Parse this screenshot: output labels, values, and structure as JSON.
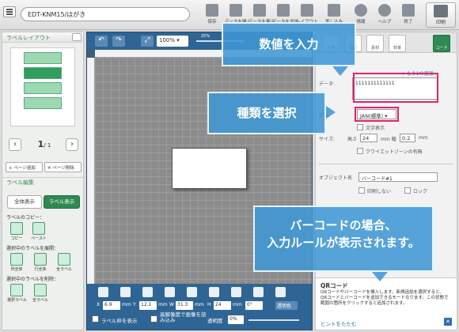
{
  "app": {
    "filename": "EDT-KNM15/はがき",
    "toolbar": [
      {
        "label": "保存"
      },
      {
        "label": "データを開く"
      },
      {
        "label": "データを書込"
      },
      {
        "label": "データを追加"
      },
      {
        "label": "レイアウト"
      },
      {
        "label": "差し込み"
      },
      {
        "label": "情報"
      },
      {
        "label": "ヘルプ"
      },
      {
        "label": "終了"
      }
    ],
    "print_label": "印刷"
  },
  "left_panel": {
    "layout_title": "ラベルレイアウト",
    "page_current": "1",
    "page_total": "/ 1",
    "add_page": "+ ページ追加",
    "delete_page": "✕ ページ削除",
    "edit_title": "ラベル編集",
    "show_all": "全体表示",
    "show_label": "ラベル表示",
    "copy_group": "ラベルのコピー：",
    "copy_btn": "コピー",
    "paste_btn": "ペースト",
    "fill_group": "選択中のラベルを展開：",
    "fill_col": "列全体",
    "fill_row": "行全体",
    "fill_all": "全ラベル",
    "delete_group": "選択中のラベルを削除：",
    "delete_selected": "選択ラベル",
    "delete_all": "全ラベル"
  },
  "canvas": {
    "zoom": "100%",
    "zoom_percent": "25%",
    "x_label": "X",
    "x_value": "6.9",
    "y_label": "Y",
    "y_value": "12.1",
    "w_label": "W",
    "w_value": "31.3",
    "h_label": "H",
    "h_value": "24",
    "unit": "mm",
    "rotation": "0°",
    "transparent_color": "透明色",
    "show_frame": "ラベル枠を表示",
    "high_res": "高解像度で画像を読み込み",
    "transparency_label": "透明度",
    "transparency_value": "0%"
  },
  "right_panel": {
    "tabs": [
      {
        "label": "文字"
      },
      {
        "label": "図形"
      },
      {
        "label": "素材"
      },
      {
        "label": "背景"
      },
      {
        "label": "コード"
      }
    ],
    "add_link": "+ もう1つ追加",
    "data_label": "データ:",
    "data_value": "1111111111111",
    "type_label": "種類:",
    "type_value": "JAN(標準)",
    "show_text": "文字表示",
    "size_label": "サイズ:",
    "height_label": "高さ",
    "height_value": "24",
    "width_label": "mm 幅",
    "width_value": "0.2",
    "width_unit": "mm",
    "quiet_zone": "クワイエットゾーンの有無",
    "object_name_label": "オブジェクト名",
    "object_name_value": "バーコード#1",
    "no_print": "印刷しない",
    "lock": "ロック",
    "help_title": "QRコード",
    "help_text": "QRコードやバーコードを挿入します。新規追加を選択すると、QRコードとバーコードを追加できるモードなります。この状態で範囲の箇所をクリックすると追加されます。",
    "help_hide": "ヒントをたたむ"
  },
  "callouts": {
    "input_value": "数値を入力",
    "select_type": "種類を選択",
    "barcode_rule_1": "バーコードの場合、",
    "barcode_rule_2": "入力ルールが表示されます。"
  },
  "colors": {
    "accent_green": "#2f8a52",
    "canvas_blue": "#2f6594",
    "callout_blue": "#3f97d5",
    "highlight_pink": "#e8216d"
  }
}
